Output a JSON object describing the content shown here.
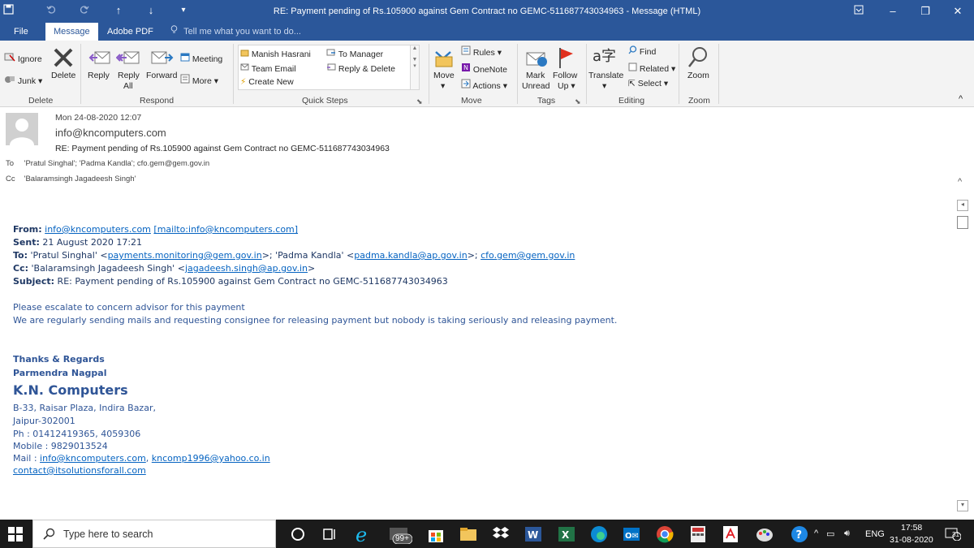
{
  "window": {
    "title": "RE: Payment pending of Rs.105900 against Gem Contract no GEMC-511687743034963  -  Message (HTML)",
    "qa_save_icon": "save-icon",
    "qa_undo_icon": "undo-icon",
    "qa_redo_icon": "redo-icon",
    "qa_up_icon": "arrow-up-icon",
    "qa_down_icon": "arrow-down-icon",
    "qa_custom_icon": "customize-icon",
    "ribbon_display_icon": "ribbon-display-options-icon",
    "min": "–",
    "restore": "❐",
    "close": "✕",
    "colors": {
      "titlebar": "#2b579a",
      "accent_text": "#2b579a",
      "link": "#0563c1",
      "body_text": "#1f3864"
    }
  },
  "menu": {
    "tabs": [
      "File",
      "Message",
      "Adobe PDF"
    ],
    "active_tab": "Message",
    "tell_me": "Tell me what you want to do..."
  },
  "ribbon": {
    "delete_group": {
      "ignore": "Ignore",
      "junk": "Junk",
      "delete": "Delete",
      "label": "Delete"
    },
    "respond_group": {
      "reply": "Reply",
      "reply_all_1": "Reply",
      "reply_all_2": "All",
      "forward": "Forward",
      "meeting": "Meeting",
      "more": "More",
      "label": "Respond"
    },
    "quick_steps": {
      "items": [
        "Manish Hasrani",
        "Team Email",
        "Create New",
        "To Manager",
        "Reply & Delete"
      ],
      "label": "Quick Steps"
    },
    "move_group": {
      "move": "Move",
      "rules": "Rules",
      "onenote": "OneNote",
      "actions": "Actions",
      "label": "Move"
    },
    "tags_group": {
      "mark_unread_1": "Mark",
      "mark_unread_2": "Unread",
      "follow_up_1": "Follow",
      "follow_up_2": "Up",
      "label": "Tags"
    },
    "editing_group": {
      "translate": "Translate",
      "find": "Find",
      "related": "Related",
      "select": "Select",
      "label": "Editing"
    },
    "zoom_group": {
      "zoom": "Zoom",
      "label": "Zoom"
    }
  },
  "header": {
    "date": "Mon 24-08-2020 12:07",
    "from": "info@kncomputers.com",
    "subject": "RE: Payment pending of Rs.105900 against Gem Contract no GEMC-511687743034963",
    "to_label": "To",
    "to": "'Pratul Singhal'; 'Padma Kandla'; cfo.gem@gem.gov.in",
    "cc_label": "Cc",
    "cc": "'Balaramsingh Jagadeesh Singh'"
  },
  "body": {
    "from_label": "From:",
    "from_link": "info@kncomputers.com",
    "from_mailto": "[mailto:info@kncomputers.com]",
    "sent_label": "Sent:",
    "sent": "21 August 2020 17:21",
    "to_label": "To:",
    "to_pre": "'Pratul Singhal' <",
    "to_link1": "payments.monitoring@gem.gov.in",
    "to_mid": ">; 'Padma Kandla' <",
    "to_link2": "padma.kandla@ap.gov.in",
    "to_mid2": ">; ",
    "to_link3": "cfo.gem@gem.gov.in",
    "cc_label": "Cc:",
    "cc_pre": "'Balaramsingh Jagadeesh Singh' <",
    "cc_link": "jagadeesh.singh@ap.gov.in",
    "cc_post": ">",
    "subject_label": "Subject:",
    "subject": "RE: Payment pending of Rs.105900 against Gem Contract no GEMC-511687743034963",
    "line1": "Please escalate to concern advisor for this payment",
    "line2": "We are regularly sending mails and requesting consignee for releasing payment but nobody is taking seriously and releasing payment.",
    "regards": "Thanks & Regards",
    "name": "Parmendra Nagpal",
    "company": "K.N. Computers",
    "addr1": "B-33, Raisar Plaza, Indira Bazar,",
    "addr2": "Jaipur-302001",
    "phone": "Ph : 01412419365, 4059306",
    "mobile": "Mobile : 9829013524",
    "mail_label": "Mail : ",
    "mail1": "info@kncomputers.com",
    "mail_sep": ", ",
    "mail2": "kncomp1996@yahoo.co.in",
    "mail3": "contact@itsolutionsforall.com"
  },
  "taskbar": {
    "search_placeholder": "Type here to search",
    "badge": "99+",
    "lang": "ENG",
    "time": "17:58",
    "date": "31-08-2020",
    "notif_count": "31"
  }
}
